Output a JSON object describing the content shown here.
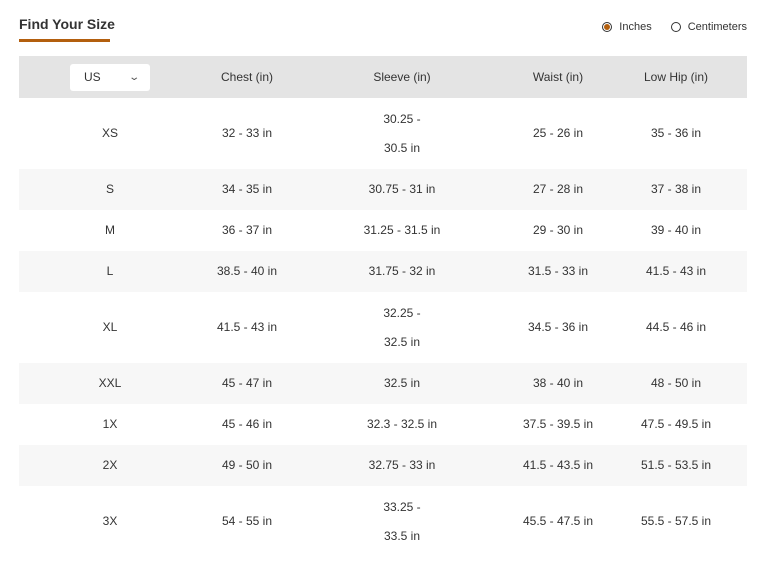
{
  "header": {
    "title": "Find Your Size",
    "units": [
      {
        "label": "Inches",
        "checked": true
      },
      {
        "label": "Centimeters",
        "checked": false
      }
    ]
  },
  "table": {
    "region_select": "US",
    "columns": [
      "Chest (in)",
      "Sleeve (in)",
      "Waist (in)",
      "Low Hip (in)"
    ],
    "rows": [
      {
        "size": "XS",
        "chest": "32 - 33 in",
        "sleeve_1": "30.25 -",
        "sleeve_2": "30.5 in",
        "waist": "25 - 26 in",
        "hip": "35 - 36 in"
      },
      {
        "size": "S",
        "chest": "34 - 35 in",
        "sleeve": "30.75 - 31 in",
        "waist": "27 - 28 in",
        "hip": "37 - 38 in"
      },
      {
        "size": "M",
        "chest": "36 - 37 in",
        "sleeve": "31.25 - 31.5 in",
        "waist": "29 - 30 in",
        "hip": "39 - 40 in"
      },
      {
        "size": "L",
        "chest": "38.5 - 40 in",
        "sleeve": "31.75 - 32 in",
        "waist": "31.5 - 33 in",
        "hip": "41.5 - 43 in"
      },
      {
        "size": "XL",
        "chest": "41.5 - 43 in",
        "sleeve_1": "32.25 -",
        "sleeve_2": "32.5 in",
        "waist": "34.5 - 36 in",
        "hip": "44.5 - 46 in"
      },
      {
        "size": "XXL",
        "chest": "45 - 47 in",
        "sleeve": "32.5 in",
        "waist": "38 - 40 in",
        "hip": "48 - 50 in"
      },
      {
        "size": "1X",
        "chest": "45 - 46 in",
        "sleeve": "32.3 - 32.5 in",
        "waist": "37.5 - 39.5 in",
        "hip": "47.5 - 49.5 in"
      },
      {
        "size": "2X",
        "chest": "49 - 50 in",
        "sleeve": "32.75 - 33 in",
        "waist": "41.5 - 43.5 in",
        "hip": "51.5 - 53.5 in"
      },
      {
        "size": "3X",
        "chest": "54 - 55 in",
        "sleeve_1": "33.25 -",
        "sleeve_2": "33.5 in",
        "waist": "45.5 - 47.5 in",
        "hip": "55.5 - 57.5 in"
      }
    ]
  },
  "colors": {
    "accent": "#b35f0e",
    "header_bg": "#e4e4e4",
    "alt_row_bg": "#f7f7f7"
  }
}
